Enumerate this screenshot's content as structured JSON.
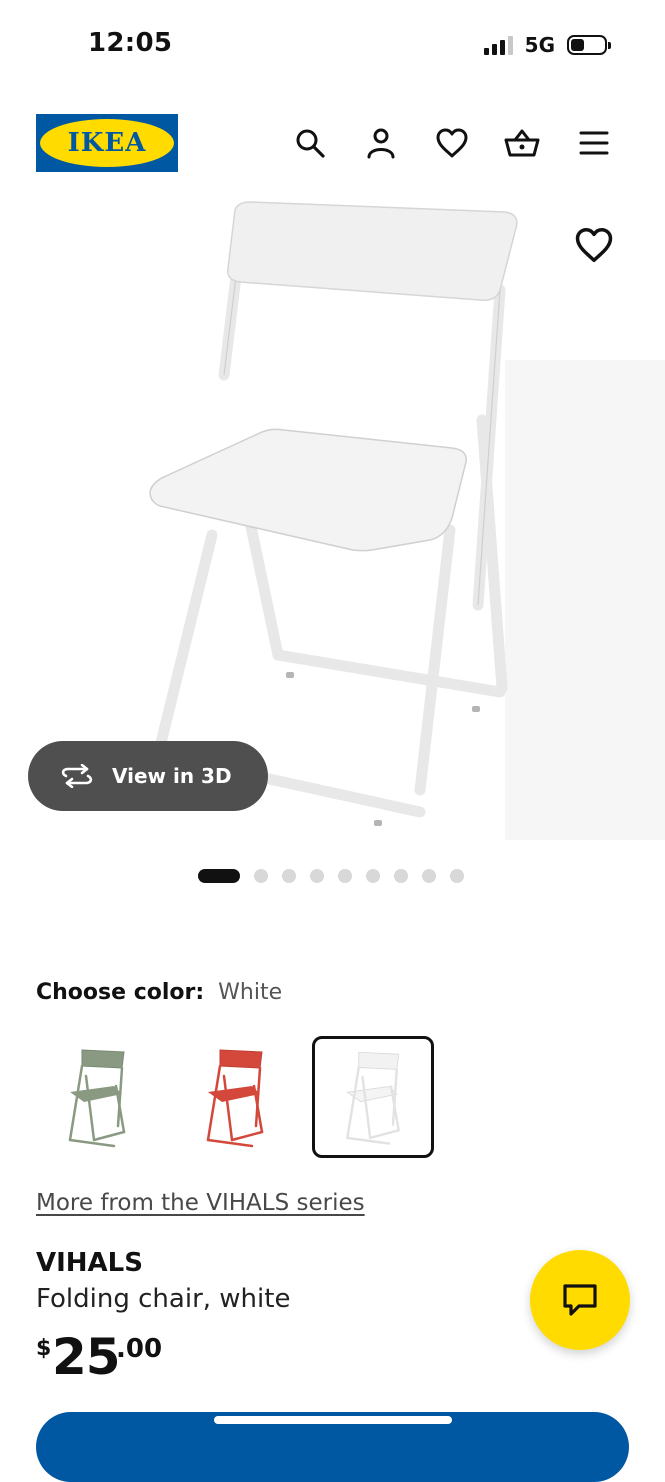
{
  "status_bar": {
    "time": "12:05",
    "network": "5G"
  },
  "header": {
    "logo_text": "IKEA",
    "icons": [
      "search-icon",
      "account-icon",
      "favorites-icon",
      "cart-icon",
      "menu-icon"
    ]
  },
  "hero": {
    "view_3d_label": "View in 3D",
    "carousel": {
      "total": 10,
      "active": 1
    }
  },
  "color_picker": {
    "label": "Choose color:",
    "selected": "White",
    "swatches": [
      "green-grey",
      "red",
      "white"
    ]
  },
  "series_link": "More from the VIHALS series",
  "product": {
    "name": "VIHALS",
    "description": "Folding chair, white",
    "price": {
      "currency": "$",
      "integer": "25",
      "decimal": ".00"
    }
  },
  "colors": {
    "ikea_blue": "#0058a3",
    "ikea_yellow": "#ffdb00",
    "view3d_bg": "#4f4f4f"
  }
}
